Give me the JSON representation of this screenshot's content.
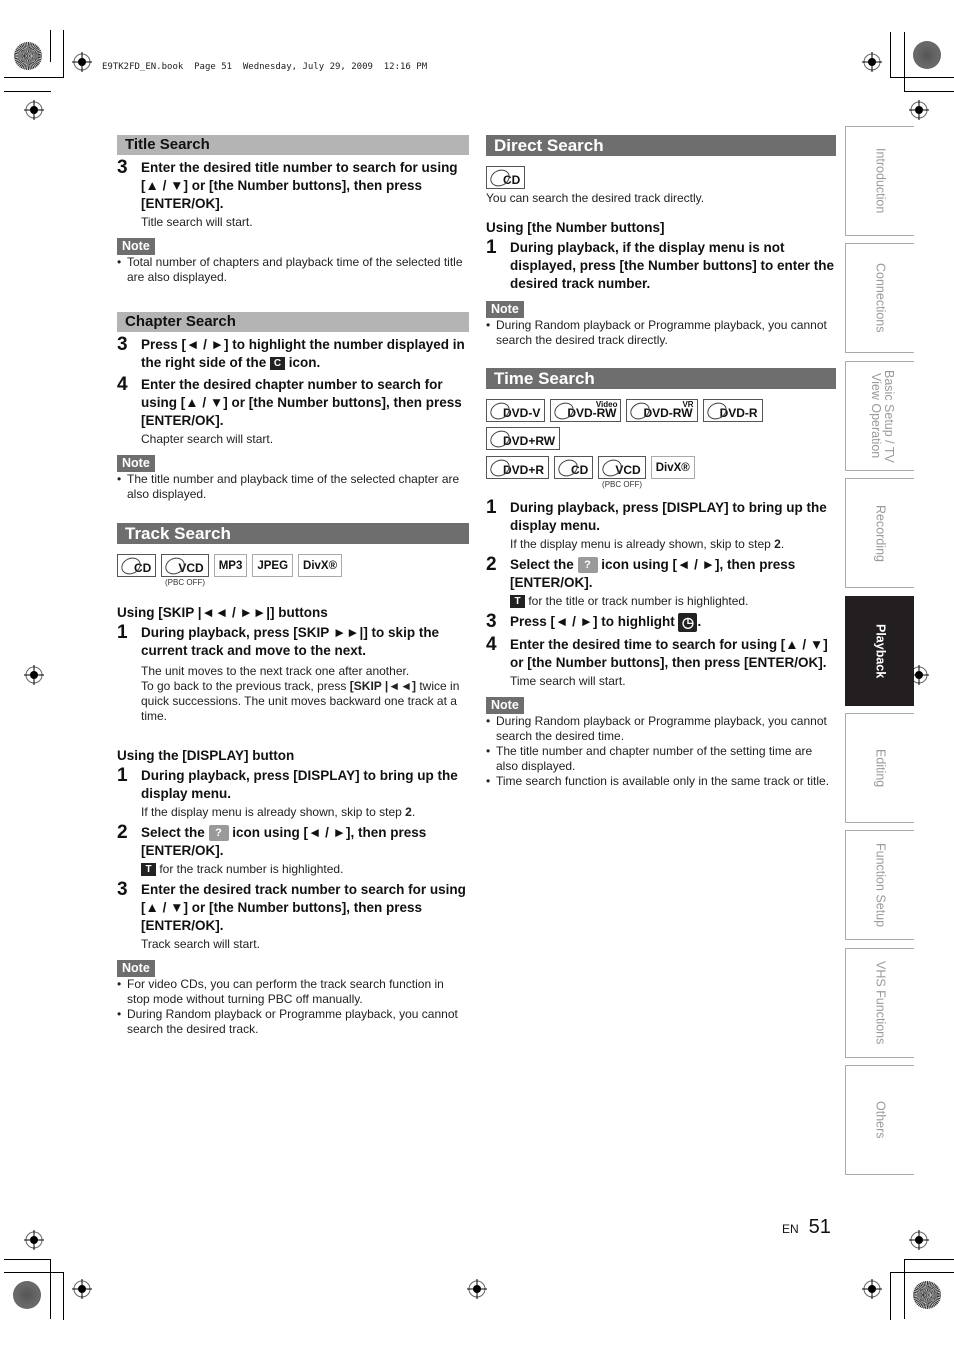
{
  "header": {
    "book_line": "E9TK2FD_EN.book  Page 51  Wednesday, July 29, 2009  12:16 PM"
  },
  "left": {
    "title_search": {
      "heading": "Title Search",
      "steps": [
        {
          "num": "3",
          "text": "Enter the desired title number to search for using [▲ / ▼] or [the Number buttons], then press [ENTER/OK].",
          "sub": "Title search will start."
        }
      ],
      "note_label": "Note",
      "notes": [
        "Total number of chapters and playback time of the selected title are also displayed."
      ]
    },
    "chapter_search": {
      "heading": "Chapter Search",
      "step3_num": "3",
      "step3_pre": "Press [◄ / ►] to highlight the number displayed in the right side of the ",
      "step3_icon": "C",
      "step3_post": " icon.",
      "step4_num": "4",
      "step4_text": "Enter the desired chapter number to search for using [▲ / ▼] or [the Number buttons], then press [ENTER/OK].",
      "step4_sub": "Chapter search will start.",
      "note_label": "Note",
      "notes": [
        "The title number and playback time of the selected chapter are also displayed."
      ]
    },
    "track_search": {
      "heading": "Track Search",
      "badges": [
        {
          "label": "CD",
          "type": "disc",
          "sub": ""
        },
        {
          "label": "VCD",
          "type": "disc",
          "sub": "(PBC OFF)"
        },
        {
          "label": "MP3",
          "type": "plain",
          "sub": ""
        },
        {
          "label": "JPEG",
          "type": "plain",
          "sub": ""
        },
        {
          "label": "DivX®",
          "type": "plain",
          "sub": ""
        }
      ],
      "skip_heading": "Using [SKIP |◄◄ / ►►|] buttons",
      "skip_step_num": "1",
      "skip_step_text": "During playback, press [SKIP ►►|] to skip the current track and move to the next.",
      "skip_sub1": "The unit moves to the next track one after another.",
      "skip_sub2_pre": "To go back to the previous track, press ",
      "skip_sub2_bold": "[SKIP |◄◄]",
      "skip_sub2_post": " twice in quick successions. The unit moves backward one track at a time.",
      "display_heading": "Using the [DISPLAY] button",
      "d1_num": "1",
      "d1_text": "During playback, press [DISPLAY] to bring up the display menu.",
      "d1_sub_pre": "If the display menu is already shown, skip to step ",
      "d1_sub_bold": "2",
      "d1_sub_post": ".",
      "d2_num": "2",
      "d2_pre": "Select the ",
      "d2_icon": "search-icon",
      "d2_post": " icon using [◄ / ►], then press [ENTER/OK].",
      "d2_sub_icon": "T",
      "d2_sub": " for the track number is highlighted.",
      "d3_num": "3",
      "d3_text": "Enter the desired track number to search for using [▲ / ▼] or [the Number buttons], then press [ENTER/OK].",
      "d3_sub": "Track search will start.",
      "note_label": "Note",
      "notes": [
        "For video CDs, you can perform the track search function in stop mode without turning PBC off manually.",
        "During Random playback or Programme playback, you cannot search the desired track."
      ]
    }
  },
  "right": {
    "direct_search": {
      "heading": "Direct Search",
      "badge": "CD",
      "intro": "You can search the desired track directly.",
      "subheading": "Using [the Number buttons]",
      "step_num": "1",
      "step_text": "During playback, if the display menu is not displayed, press [the Number buttons] to enter the desired track number.",
      "note_label": "Note",
      "notes": [
        "During Random playback or Programme playback, you cannot search the desired track directly."
      ]
    },
    "time_search": {
      "heading": "Time Search",
      "badges_row1": [
        {
          "label": "DVD-V",
          "tag": ""
        },
        {
          "label": "DVD-RW",
          "tag": "Video"
        },
        {
          "label": "DVD-RW",
          "tag": "VR"
        },
        {
          "label": "DVD-R",
          "tag": ""
        },
        {
          "label": "DVD+RW",
          "tag": ""
        }
      ],
      "badges_row2": [
        {
          "label": "DVD+R",
          "type": "disc",
          "sub": ""
        },
        {
          "label": "CD",
          "type": "disc",
          "sub": ""
        },
        {
          "label": "VCD",
          "type": "disc",
          "sub": "(PBC OFF)"
        },
        {
          "label": "DivX®",
          "type": "plain",
          "sub": ""
        }
      ],
      "s1_num": "1",
      "s1_text": "During playback, press [DISPLAY] to bring up the display menu.",
      "s1_sub_pre": "If the display menu is already shown, skip to step ",
      "s1_sub_bold": "2",
      "s1_sub_post": ".",
      "s2_num": "2",
      "s2_pre": "Select the ",
      "s2_post": " icon using [◄ / ►], then press [ENTER/OK].",
      "s2_sub_icon": "T",
      "s2_sub": " for the title or track number is highlighted.",
      "s3_num": "3",
      "s3_pre": "Press [◄ / ►] to highlight ",
      "s3_post": ".",
      "s4_num": "4",
      "s4_text": "Enter the desired time to search for using [▲ / ▼] or [the Number buttons], then press [ENTER/OK].",
      "s4_sub": "Time search will start.",
      "note_label": "Note",
      "notes": [
        "During Random playback or Programme playback, you cannot search the desired time.",
        "The title number and chapter number of the setting time are also displayed.",
        "Time search function is available only in the same track or title."
      ]
    }
  },
  "side_tabs": [
    {
      "label": "Introduction",
      "active": false
    },
    {
      "label": "Connections",
      "active": false
    },
    {
      "label": "Basic Setup / TV View Operation",
      "active": false
    },
    {
      "label": "Recording",
      "active": false
    },
    {
      "label": "Playback",
      "active": true
    },
    {
      "label": "Editing",
      "active": false
    },
    {
      "label": "Function Setup",
      "active": false
    },
    {
      "label": "VHS Functions",
      "active": false
    },
    {
      "label": "Others",
      "active": false
    }
  ],
  "footer": {
    "lang": "EN",
    "page": "51"
  },
  "colors": {
    "light_header": "#b4b4b4",
    "dark_header": "#6e6e6e",
    "active_tab": "#231f20",
    "tab_text": "#9a9a9a"
  }
}
